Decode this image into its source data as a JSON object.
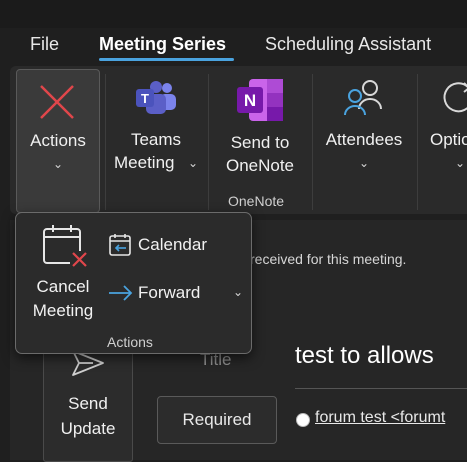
{
  "tabs": [
    {
      "label": "File"
    },
    {
      "label": "Meeting Series"
    },
    {
      "label": "Scheduling Assistant"
    }
  ],
  "ribbon": {
    "actions": {
      "label": "Actions"
    },
    "teams": {
      "line1": "Teams",
      "line2": "Meeting"
    },
    "onenote": {
      "line1": "Send to",
      "line2": "OneNote",
      "group_label": "OneNote"
    },
    "attendees": {
      "label": "Attendees"
    },
    "options": {
      "label": "Optio"
    }
  },
  "actions_popup": {
    "cancel_line1": "Cancel",
    "cancel_line2": "Meeting",
    "calendar": "Calendar",
    "forward": "Forward",
    "group_label": "Actions"
  },
  "body": {
    "info_text": "received for this meeting.",
    "send_line1": "Send",
    "send_line2": "Update",
    "title_label": "Title",
    "title_value": "test to allows",
    "required_label": "Required",
    "attendee_link": "forum test <forumt"
  },
  "colors": {
    "accent": "#4aa3df",
    "cancel_red": "#e0464b",
    "teams_purple": "#5b5fc7",
    "onenote_purple": "#7719aa",
    "forward_blue": "#4aa3df"
  }
}
